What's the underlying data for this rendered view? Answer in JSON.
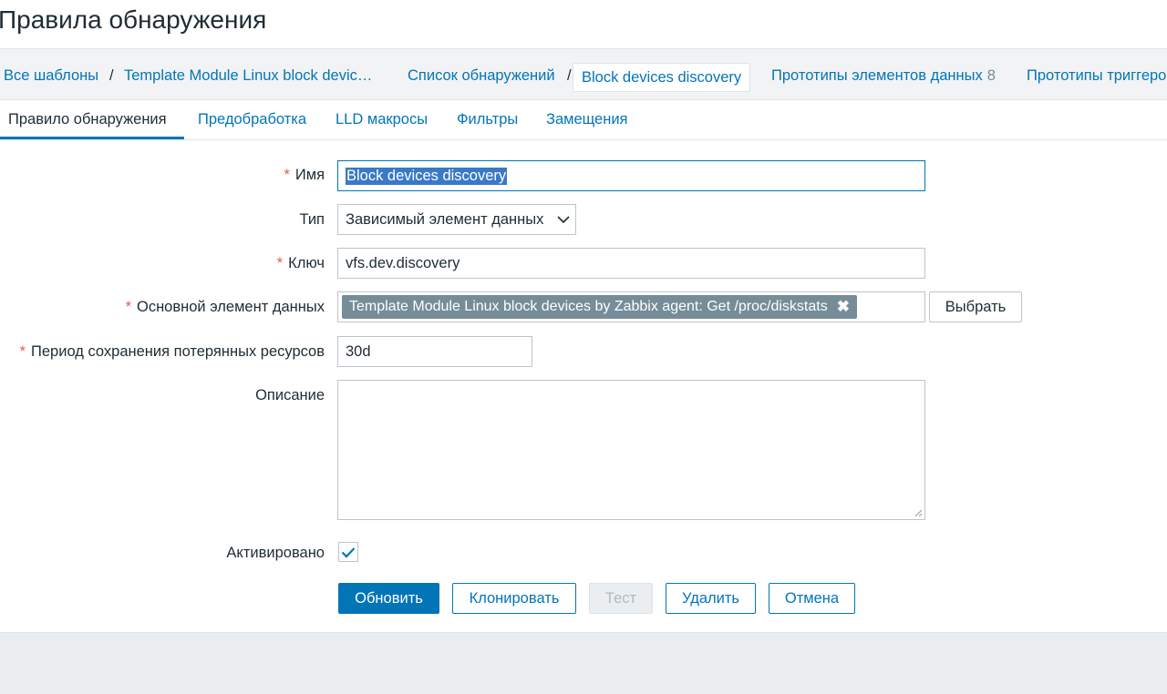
{
  "page": {
    "title": "Правила обнаружения"
  },
  "breadcrumbs": {
    "all_templates": "Все шаблоны",
    "separator": "/",
    "template": "Template Module Linux block devic…",
    "discovery_list": "Список обнаружений",
    "current": "Block devices discovery",
    "item_prototypes": "Прототипы элементов данных",
    "item_prototypes_count": "8",
    "trigger_prototypes": "Прототипы триггеро"
  },
  "tabs": [
    {
      "label": "Правило обнаружения",
      "active": true
    },
    {
      "label": "Предобработка"
    },
    {
      "label": "LLD макросы"
    },
    {
      "label": "Фильтры"
    },
    {
      "label": "Замещения"
    }
  ],
  "form": {
    "required_mark": "*",
    "name_label": "Имя",
    "name_value": "Block devices discovery",
    "type_label": "Тип",
    "type_value": "Зависимый элемент данных",
    "key_label": "Ключ",
    "key_value": "vfs.dev.discovery",
    "master_item_label": "Основной элемент данных",
    "master_item_value": "Template Module Linux block devices by Zabbix agent: Get /proc/diskstats",
    "select_button": "Выбрать",
    "lost_period_label": "Период сохранения потерянных ресурсов",
    "lost_period_value": "30d",
    "description_label": "Описание",
    "description_value": "",
    "enabled_label": "Активировано",
    "enabled": true
  },
  "buttons": {
    "update": "Обновить",
    "clone": "Клонировать",
    "test": "Тест",
    "delete": "Удалить",
    "cancel": "Отмена"
  },
  "colors": {
    "accent": "#0275b8",
    "required": "#e45959",
    "chip": "#768d99"
  }
}
